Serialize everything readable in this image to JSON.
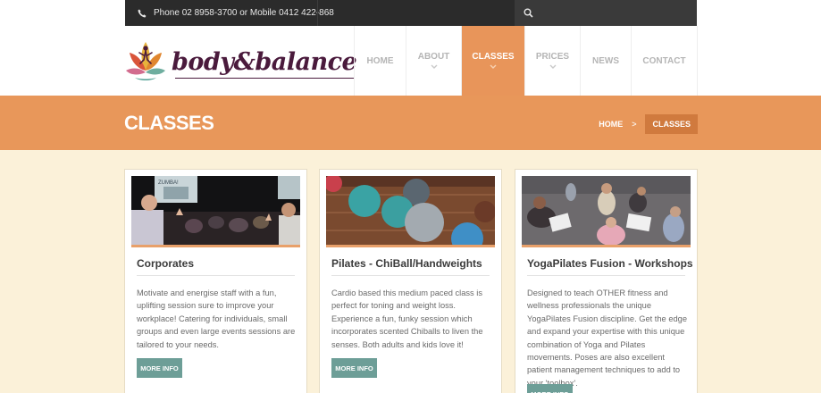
{
  "topbar": {
    "phone_text": "Phone 02 8958-3700 or Mobile 0412 422-868",
    "phone_icon": "phone-icon",
    "search_icon": "search-icon"
  },
  "header": {
    "logo_text": "body&balance",
    "nav": [
      {
        "label": "HOME",
        "has_dropdown": false,
        "active": false
      },
      {
        "label": "ABOUT",
        "has_dropdown": true,
        "active": false
      },
      {
        "label": "CLASSES",
        "has_dropdown": true,
        "active": true
      },
      {
        "label": "PRICES",
        "has_dropdown": true,
        "active": false
      },
      {
        "label": "NEWS",
        "has_dropdown": false,
        "active": false
      },
      {
        "label": "CONTACT",
        "has_dropdown": false,
        "active": false
      }
    ]
  },
  "band": {
    "title": "CLASSES",
    "breadcrumb": {
      "home": "HOME",
      "separator": ">",
      "current": "CLASSES"
    }
  },
  "cards": [
    {
      "title": "Corporates",
      "text": "Motivate and energise staff with a fun, uplifting session sure to improve your workplace! Catering for individuals, small groups and even large events sessions are tailored to your needs.",
      "button": "MORE INFO",
      "image_label": "ZUMBA!"
    },
    {
      "title": "Pilates - ChiBall/Handweights",
      "text": "Cardio based this medium paced class is perfect for toning and weight loss. Experience a fun, funky session which incorporates scented Chiballs to liven the senses. Both adults and kids love it!",
      "button": "MORE INFO"
    },
    {
      "title": "YogaPilates Fusion - Workshops",
      "text": "Designed to teach OTHER fitness and wellness professionals the unique YogaPilates Fusion discipline. Get the edge and expand your expertise with this unique combination of Yoga and Pilates movements. Poses are also excellent patient management techniques to add to your 'toolbox'.",
      "button": "MORE INFO"
    }
  ],
  "colors": {
    "accent_orange": "#e8975a",
    "page_bg": "#fbf1d9",
    "button_teal": "#6d9e97",
    "topbar_dark": "#2b2b2b",
    "logo_purple": "#4a1a3c"
  }
}
